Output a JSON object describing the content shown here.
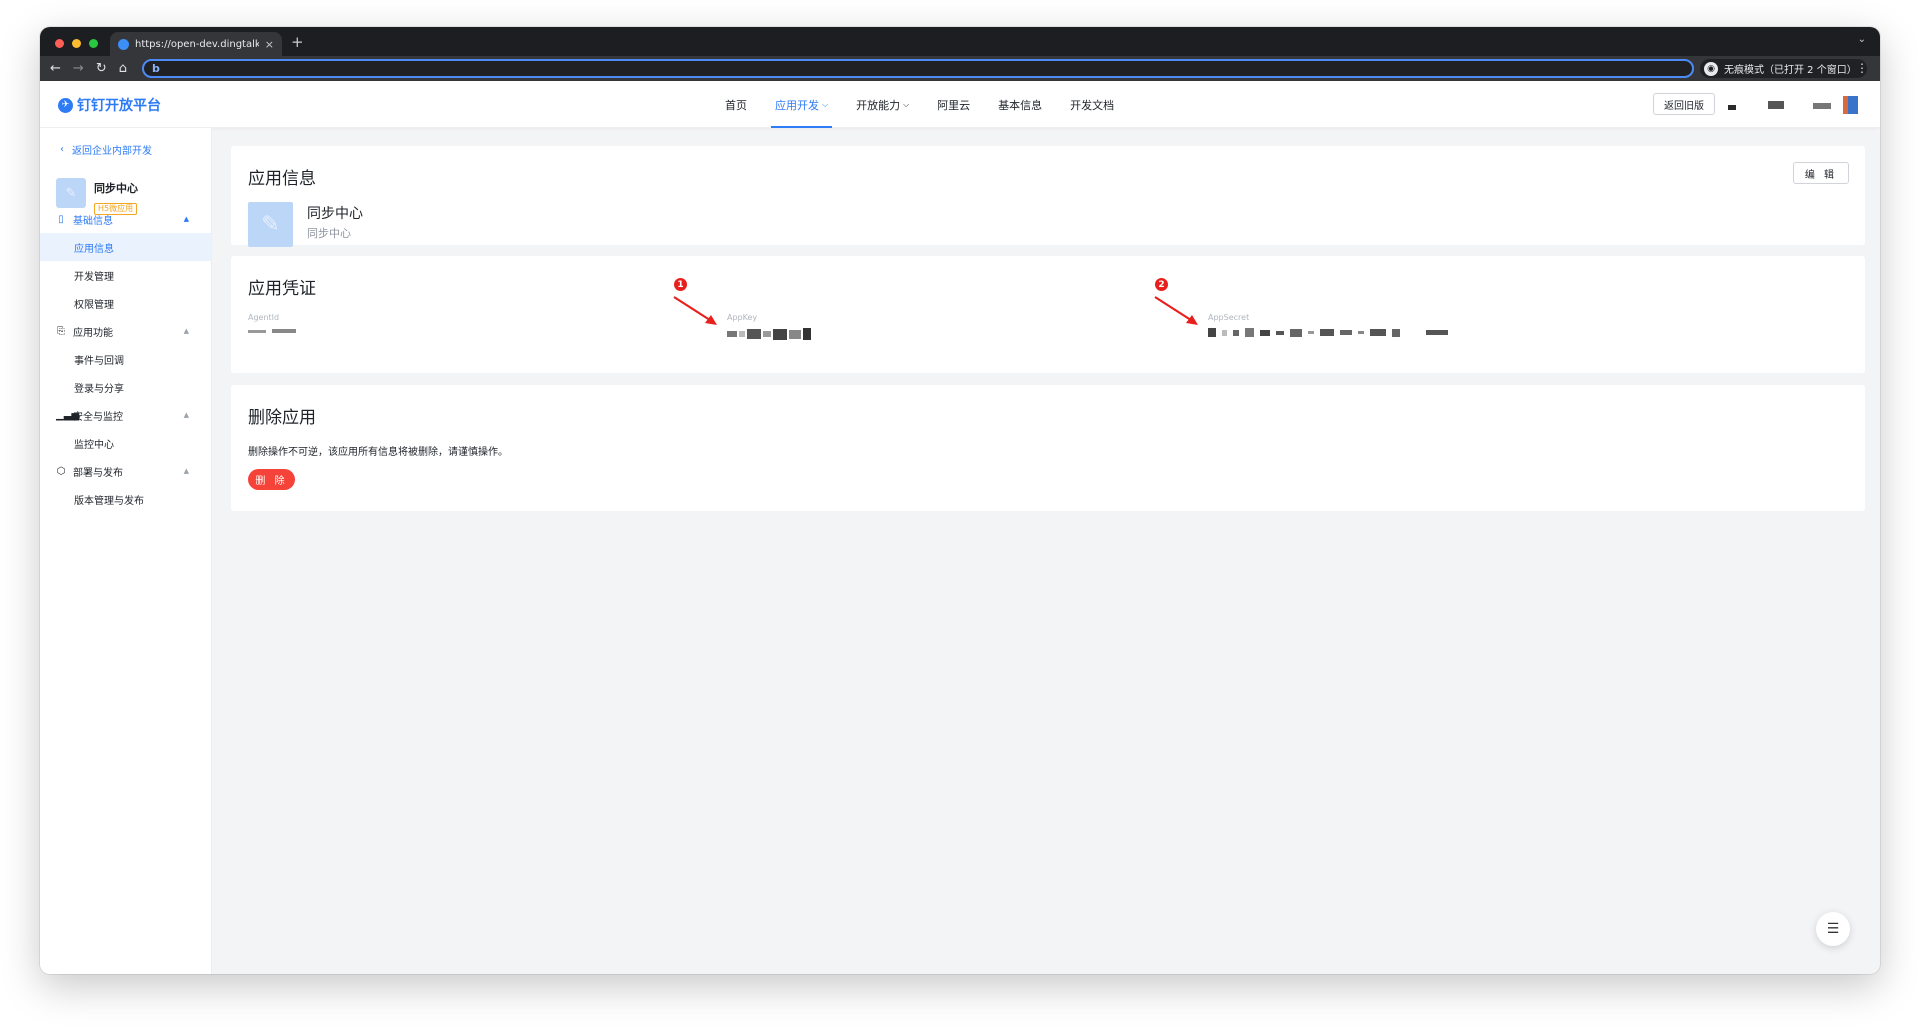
{
  "browser": {
    "tab_title": "https://open-dev.dingtalk.com/",
    "tab_close": "×",
    "new_tab": "+",
    "tab_menu": "⌄",
    "incognito_label": "无痕模式（已打开 2 个窗口）",
    "omnibox_cursor": "b",
    "kebab": "⋮"
  },
  "header": {
    "logo_text": "钉钉开放平台",
    "nav": [
      {
        "label": "首页"
      },
      {
        "label": "应用开发"
      },
      {
        "label": "开放能力"
      },
      {
        "label": "阿里云"
      },
      {
        "label": "基本信息"
      },
      {
        "label": "开发文档"
      }
    ],
    "old_version_button": "返回旧版"
  },
  "sidebar": {
    "back_link": "返回企业内部开发",
    "app_name": "同步中心",
    "app_tag": "H5微应用",
    "groups": [
      {
        "label": "基础信息",
        "items": [
          "应用信息",
          "开发管理",
          "权限管理"
        ]
      },
      {
        "label": "应用功能",
        "items": [
          "事件与回调",
          "登录与分享"
        ]
      },
      {
        "label": "安全与监控",
        "items": [
          "监控中心"
        ]
      },
      {
        "label": "部署与发布",
        "items": [
          "版本管理与发布"
        ]
      }
    ]
  },
  "app_info": {
    "title": "应用信息",
    "edit_button": "编 辑",
    "app_name": "同步中心",
    "app_desc": "同步中心"
  },
  "credentials": {
    "title": "应用凭证",
    "agentid_label": "AgentId",
    "appkey_label": "AppKey",
    "appsecret_label": "AppSecret",
    "badge_1": "1",
    "badge_2": "2"
  },
  "delete_app": {
    "title": "删除应用",
    "description": "删除操作不可逆，该应用所有信息将被删除，请谨慎操作。",
    "delete_button": "删 除"
  },
  "colors": {
    "primary": "#2e7bf6",
    "danger": "#f5433a",
    "badge": "#e8201d"
  }
}
